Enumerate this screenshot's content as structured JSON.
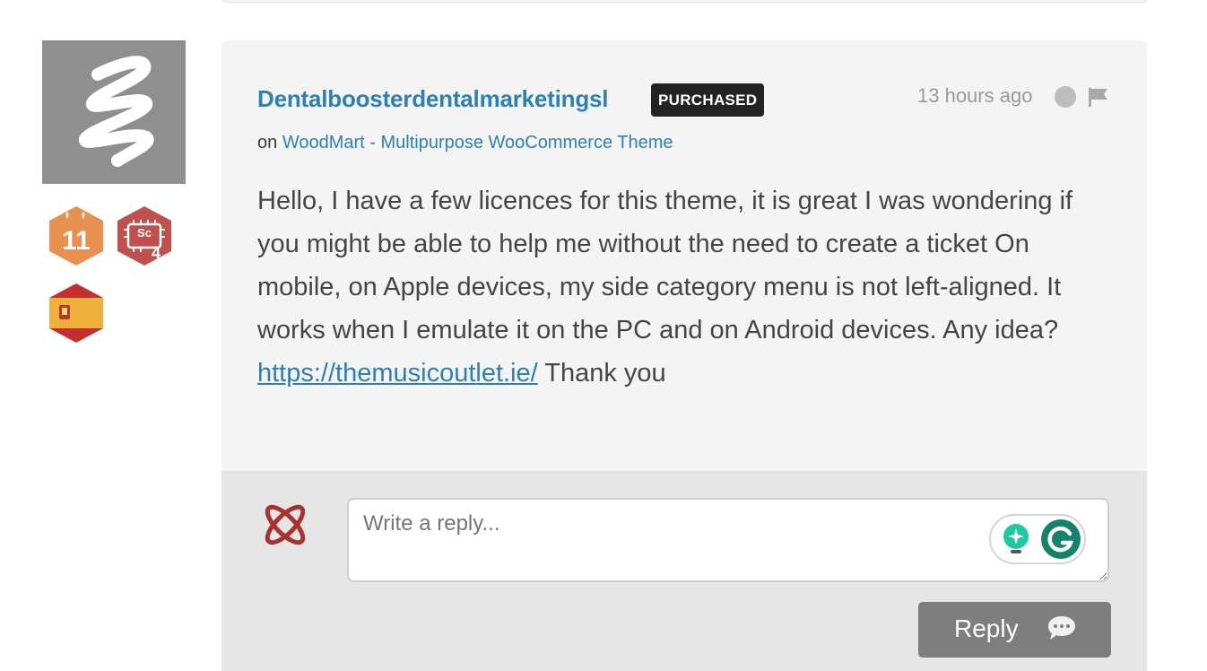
{
  "comment": {
    "username": "Dentalboosterdentalmarketingsl",
    "purchased_badge": "PURCHASED",
    "timestamp": "13 hours ago",
    "on_prefix": "on",
    "item_link": "WoodMart - Multipurpose WooCommerce Theme",
    "body_before_link": "Hello, I have a few licences for this theme, it is great I was wondering if you might be able to help me without the need to create a ticket On mobile, on Apple devices, my side category menu is not left-aligned. It works when I emulate it on the PC and on Android devices. Any idea? ",
    "body_link": "https://themusicoutlet.ie/",
    "body_after_link": " Thank you"
  },
  "author_badges": {
    "years_badge": "11",
    "sales_badge": "Sc",
    "sales_level": "4",
    "country_badge_icon": "spain-flag-icon"
  },
  "reply": {
    "placeholder": "Write a reply...",
    "button_label": "Reply"
  },
  "colors": {
    "link": "#2d7fb5",
    "purchased_bg": "#232323",
    "comment_bg": "#f4f4f4",
    "reply_bg": "#e6e6e6",
    "button_bg": "#7e7e7e",
    "years_badge": "#e8904f",
    "sales_badge": "#c0504d"
  }
}
